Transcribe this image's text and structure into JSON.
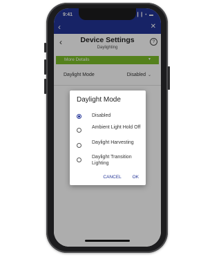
{
  "status_bar": {
    "time": "9:41",
    "icons": "▎▎• ▬"
  },
  "app_bar": {
    "back_icon": "chevron-left-icon",
    "close_icon": "close-icon"
  },
  "header": {
    "back_glyph": "‹",
    "title": "Device Settings",
    "subtitle": "Daylighting",
    "help_glyph": "?"
  },
  "details": {
    "label": "More Details",
    "caret": "▾"
  },
  "setting": {
    "label": "Daylight Mode",
    "value": "Disabled",
    "caret": "⌄"
  },
  "dialog": {
    "title": "Daylight Mode",
    "options": [
      {
        "label": "Disabled",
        "selected": true
      },
      {
        "label": "Ambient Light Hold Off",
        "selected": false
      },
      {
        "label": "Daylight Harvesting",
        "selected": false
      },
      {
        "label": "Daylight Transition Lighting",
        "selected": false
      }
    ],
    "cancel_label": "CANCEL",
    "ok_label": "OK"
  },
  "colors": {
    "primary": "#233497",
    "accent_green": "#7cbf2a"
  }
}
